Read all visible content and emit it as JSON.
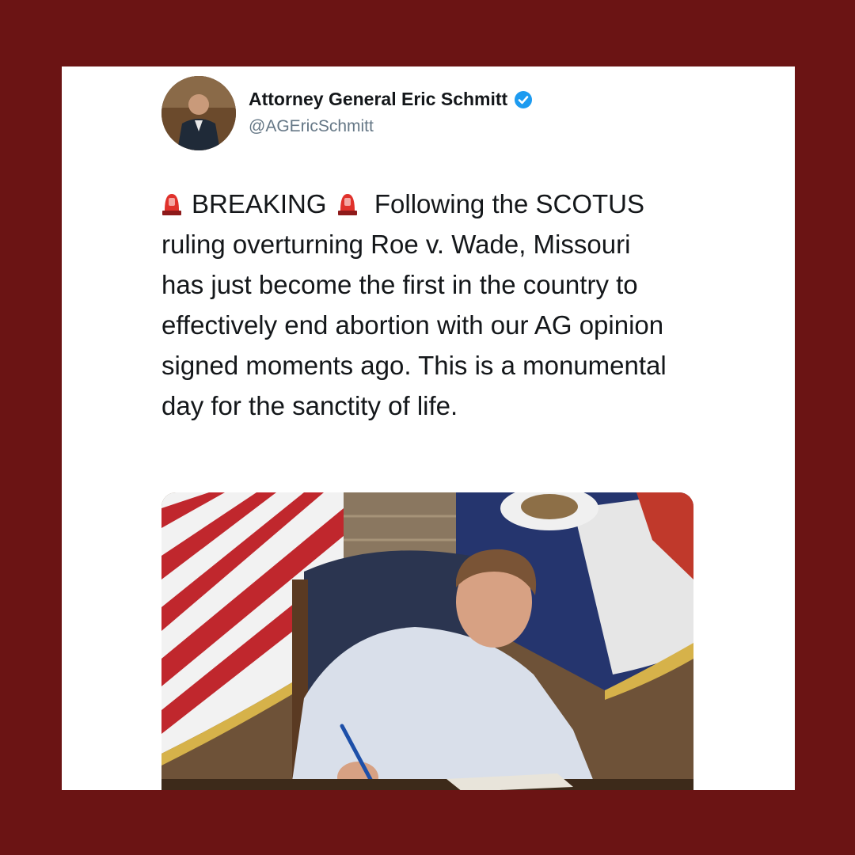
{
  "tweet": {
    "display_name": "Attorney General Eric Schmitt",
    "handle": "@AGEricSchmitt",
    "verified": true,
    "verified_icon": "verified-badge-icon",
    "text_prefix_icon": "rotating-light-icon",
    "text_breaking": "BREAKING",
    "text_body": "Following the SCOTUS ruling overturning Roe v. Wade, Missouri has just become the first in the country to effectively end abortion with our AG opinion signed moments ago. This is a monumental day for the sanctity of life."
  },
  "colors": {
    "frame": "#6b1414",
    "card": "#ffffff",
    "verified": "#1d9bf0",
    "text": "#14171a",
    "handle": "#657786"
  }
}
